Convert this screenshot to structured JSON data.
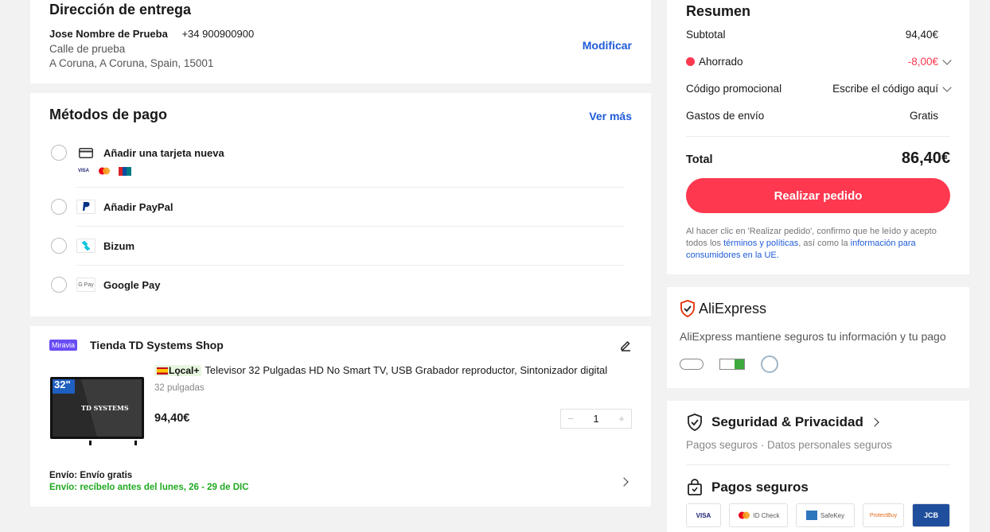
{
  "address": {
    "title": "Dirección de entrega",
    "name": "Jose Nombre de Prueba",
    "phone": "+34 900900900",
    "street": "Calle de prueba",
    "city": "A Coruna, A Coruna, Spain, 15001",
    "modify": "Modificar"
  },
  "payment": {
    "title": "Métodos de pago",
    "see_more": "Ver más",
    "methods": [
      {
        "label": "Añadir una tarjeta nueva",
        "icon": "credit-card-icon"
      },
      {
        "label": "Añadir PayPal",
        "icon": "paypal-icon"
      },
      {
        "label": "Bizum",
        "icon": "bizum-icon"
      },
      {
        "label": "Google Pay",
        "icon": "google-pay-icon",
        "icon_text": "G Pay"
      }
    ],
    "card_brands": [
      "VISA",
      "MC",
      "UP"
    ]
  },
  "shop": {
    "badge": "Miravia",
    "name": "Tienda TD Systems Shop",
    "local_badge": "Lǫcal+",
    "product_title": "Televisor 32 Pulgadas HD No Smart TV, USB Grabador reproductor, Sintonizador digital",
    "variant": "32 pulgadas",
    "price": "94,40€",
    "quantity": "1",
    "qty_minus": "−",
    "qty_plus": "+",
    "tv_size": "32\"",
    "tv_brand": "TD SYSTEMS",
    "shipping_label": "Envío: Envío gratis",
    "delivery": "Envío: recíbelo antes del lunes, 26 - 29 de DIC"
  },
  "summary": {
    "title": "Resumen",
    "subtotal_label": "Subtotal",
    "subtotal": "94,40€",
    "saved_label": "Ahorrado",
    "saved": "-8,00€",
    "promo_label": "Código promocional",
    "promo_placeholder": "Escribe el código aquí",
    "shipping_label": "Gastos de envío",
    "shipping": "Gratis",
    "total_label": "Total",
    "total": "86,40€",
    "place_order": "Realizar pedido",
    "legal_1": "Al hacer clic en 'Realizar pedido', confirmo que he leído y acepto todos los ",
    "legal_link1": "términos y políticas",
    "legal_2": ", así como la ",
    "legal_link2": "información para consumidores en la UE."
  },
  "aliexpress": {
    "brand": "AliExpress",
    "text": "AliExpress mantiene seguros tu información y tu pago"
  },
  "security": {
    "title": "Seguridad & Privacidad",
    "sub": "Pagos seguros · Datos personales seguros",
    "payments_title": "Pagos seguros",
    "badges": [
      "VISA",
      "ID Check",
      "SafeKey",
      "ProtectBuy",
      "JCB"
    ]
  },
  "colors": {
    "accent": "#fd384f",
    "link": "#1f5bd8",
    "green": "#21a921",
    "saved": "#fd384f"
  }
}
